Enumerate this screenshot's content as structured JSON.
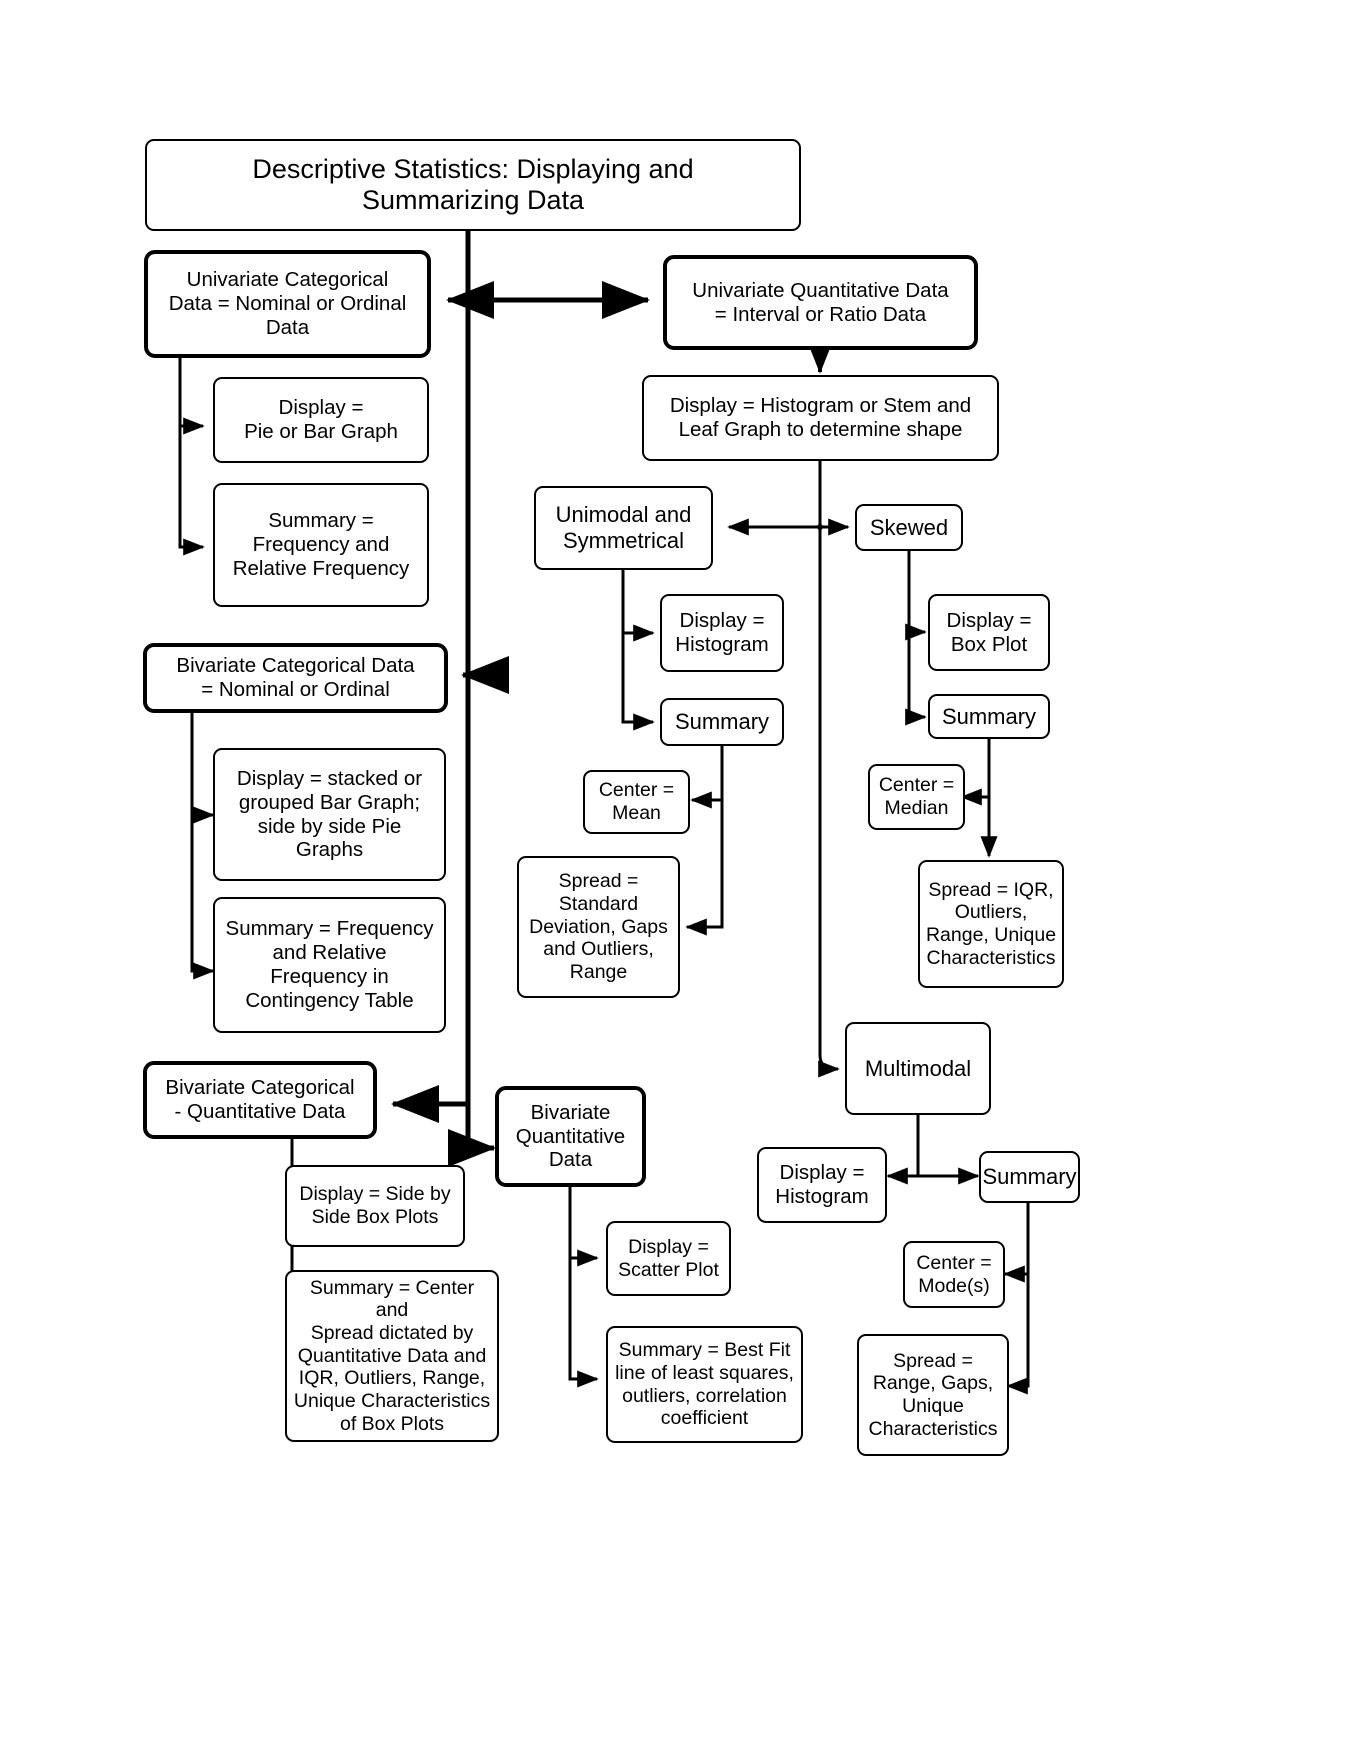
{
  "diagram": {
    "title": "Descriptive Statistics: Displaying and Summarizing Data",
    "type": "flowchart",
    "nodes": {
      "root": {
        "label": "Descriptive Statistics: Displaying and\nSummarizing Data"
      },
      "uni_cat": {
        "label": "Univariate Categorical\nData = Nominal or Ordinal\nData"
      },
      "uni_cat_display": {
        "label": "Display =\nPie or Bar Graph"
      },
      "uni_cat_summary": {
        "label": "Summary =\nFrequency and\nRelative Frequency"
      },
      "bi_cat": {
        "label": "Bivariate Categorical Data\n= Nominal or Ordinal"
      },
      "bi_cat_display": {
        "label": "Display = stacked or\ngrouped Bar Graph;\nside by side Pie\nGraphs"
      },
      "bi_cat_summary": {
        "label": "Summary = Frequency\nand Relative\nFrequency in\nContingency Table"
      },
      "bi_cat_quant": {
        "label": "Bivariate Categorical\n- Quantitative Data"
      },
      "bi_cq_display": {
        "label": "Display = Side by\nSide Box Plots"
      },
      "bi_cq_summary": {
        "label": "Summary = Center and\nSpread dictated by\nQuantitative Data and\nIQR, Outliers, Range,\nUnique Characteristics\nof Box Plots"
      },
      "bi_quant": {
        "label": "Bivariate\nQuantitative\nData"
      },
      "bi_q_display": {
        "label": "Display =\nScatter Plot"
      },
      "bi_q_summary": {
        "label": "Summary =  Best Fit\nline of least squares,\noutliers, correlation\ncoefficient"
      },
      "uni_quant": {
        "label": "Univariate Quantitative Data\n= Interval or Ratio Data"
      },
      "uni_quant_display": {
        "label": "Display = Histogram or Stem and\nLeaf Graph to determine shape"
      },
      "unimodal": {
        "label": "Unimodal and\nSymmetrical"
      },
      "unimodal_display": {
        "label": "Display =\nHistogram"
      },
      "unimodal_summary": {
        "label": "Summary"
      },
      "unimodal_center": {
        "label": "Center =\nMean"
      },
      "unimodal_spread": {
        "label": "Spread =\nStandard\nDeviation, Gaps\nand Outliers,\nRange"
      },
      "skewed": {
        "label": "Skewed"
      },
      "skewed_display": {
        "label": "Display =\nBox Plot"
      },
      "skewed_summary": {
        "label": "Summary"
      },
      "skewed_center": {
        "label": "Center =\nMedian"
      },
      "skewed_spread": {
        "label": "Spread = IQR,\nOutliers,\nRange, Unique\nCharacteristics"
      },
      "multimodal": {
        "label": "Multimodal"
      },
      "multi_display": {
        "label": "Display =\nHistogram"
      },
      "multi_summary": {
        "label": "Summary"
      },
      "multi_center": {
        "label": "Center =\nMode(s)"
      },
      "multi_spread": {
        "label": "Spread =\nRange, Gaps,\nUnique\nCharacteristics"
      }
    },
    "colors": {
      "line": "#000000",
      "node_fill": "#ffffff",
      "node_stroke": "#000000",
      "text": "#000000"
    }
  }
}
